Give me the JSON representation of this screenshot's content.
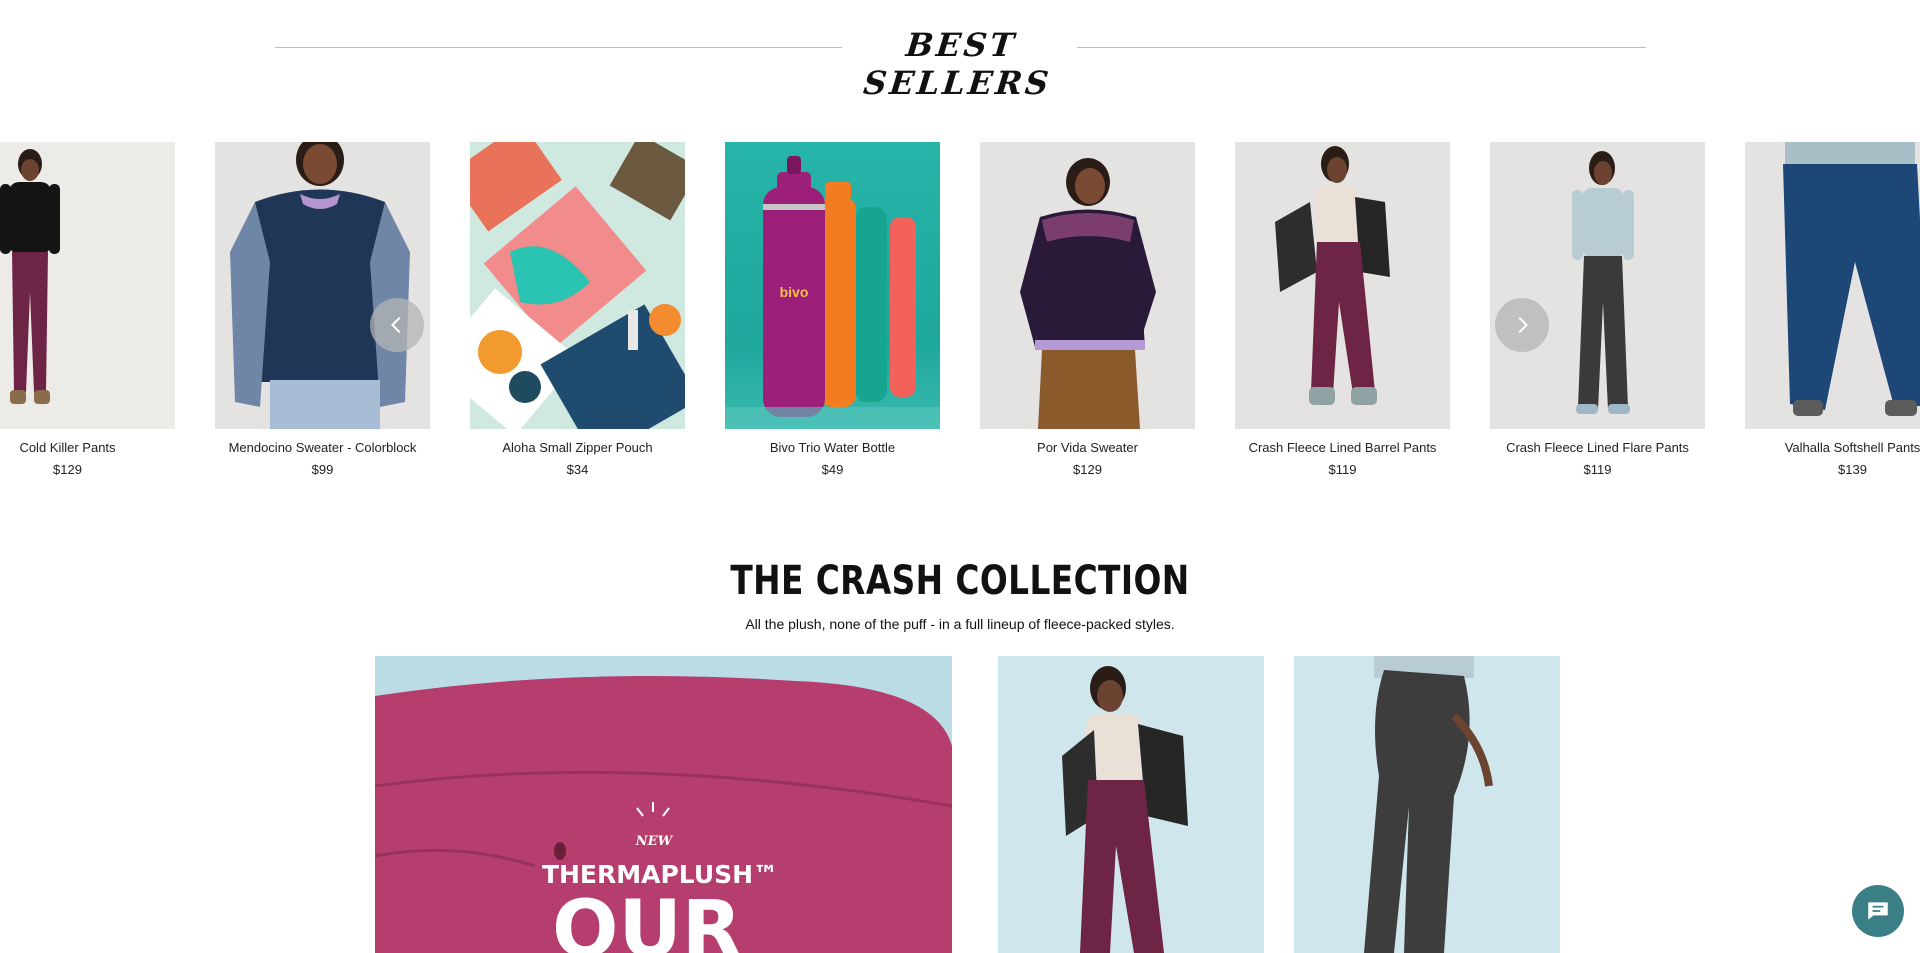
{
  "best_sellers": {
    "title": "BEST SELLERS",
    "products": [
      {
        "name": "Cold Killer Pants",
        "price": "$129"
      },
      {
        "name": "Mendocino Sweater - Colorblock",
        "price": "$99"
      },
      {
        "name": "Aloha Small Zipper Pouch",
        "price": "$34"
      },
      {
        "name": "Bivo Trio Water Bottle",
        "price": "$49"
      },
      {
        "name": "Por Vida Sweater",
        "price": "$129"
      },
      {
        "name": "Crash Fleece Lined Barrel Pants",
        "price": "$119"
      },
      {
        "name": "Crash Fleece Lined Flare Pants",
        "price": "$119"
      },
      {
        "name": "Valhalla Softshell Pants",
        "price": "$139"
      }
    ],
    "bottle_brand": "bivo"
  },
  "crash_collection": {
    "title": "THE CRASH COLLECTION",
    "subtitle": "All the plush, none of the puff - in a full lineup of fleece-packed styles.",
    "hero_badge": "NEW",
    "hero_line1": "THERMAPLUSH™",
    "hero_line2": "OUR"
  },
  "icons": {
    "prev": "chevron-left-icon",
    "next": "chevron-right-icon",
    "chat": "chat-bubble-icon"
  },
  "colors": {
    "accent_teal": "#3a7f86",
    "plum": "#7a2a4f",
    "navy": "#213a5c"
  }
}
